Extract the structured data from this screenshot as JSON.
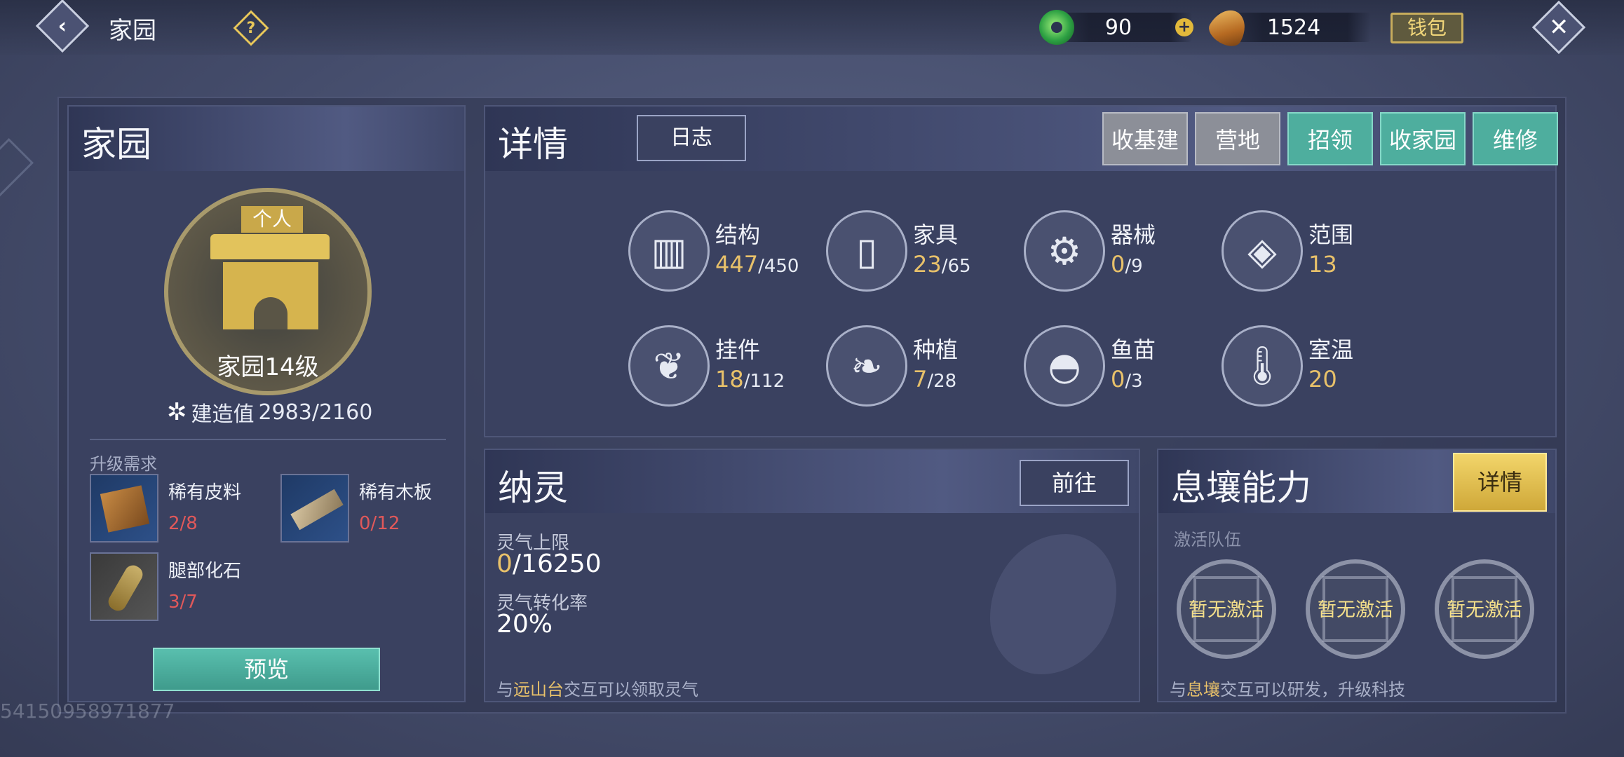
{
  "topbar": {
    "title": "家园",
    "help_icon": "?",
    "jade_amount": "90",
    "coin_amount": "1524",
    "wallet_label": "钱包"
  },
  "left_panel": {
    "title": "家园",
    "emblem_tag": "个人",
    "level_label": "家园14级",
    "build_label": "建造值",
    "build_value": "2983/2160",
    "requirements_title": "升级需求",
    "materials": [
      {
        "name": "稀有皮料",
        "count": "2/8",
        "icon": "leather-icon"
      },
      {
        "name": "稀有木板",
        "count": "0/12",
        "icon": "wood-plank-icon"
      },
      {
        "name": "腿部化石",
        "count": "3/7",
        "icon": "fossil-icon"
      }
    ],
    "preview_label": "预览"
  },
  "detail_panel": {
    "title": "详情",
    "log_label": "日志",
    "actions": [
      "收基建",
      "营地",
      "招领",
      "收家园",
      "维修"
    ],
    "stats": [
      {
        "name": "结构",
        "value": "447",
        "max": "/450",
        "icon": "structure-icon"
      },
      {
        "name": "家具",
        "value": "23",
        "max": "/65",
        "icon": "furniture-icon"
      },
      {
        "name": "器械",
        "value": "0",
        "max": "/9",
        "icon": "machinery-icon"
      },
      {
        "name": "范围",
        "value": "13",
        "max": "",
        "icon": "range-icon"
      },
      {
        "name": "挂件",
        "value": "18",
        "max": "/112",
        "icon": "pendant-icon"
      },
      {
        "name": "种植",
        "value": "7",
        "max": "/28",
        "icon": "planting-icon"
      },
      {
        "name": "鱼苗",
        "value": "0",
        "max": "/3",
        "icon": "fish-fry-icon"
      },
      {
        "name": "室温",
        "value": "20",
        "max": "",
        "icon": "thermometer-icon"
      }
    ]
  },
  "spirit_panel": {
    "title": "纳灵",
    "goto_label": "前往",
    "limit_label": "灵气上限",
    "limit_current": "0",
    "limit_max": "/16250",
    "rate_label": "灵气转化率",
    "rate_value": "20%",
    "footer_prefix": "与",
    "footer_highlight": "远山台",
    "footer_suffix": "交互可以领取灵气"
  },
  "ability_panel": {
    "title": "息壤能力",
    "detail_label": "详情",
    "team_label": "激活队伍",
    "slots": [
      "暂无激活",
      "暂无激活",
      "暂无激活"
    ],
    "footer_prefix": "与",
    "footer_highlight": "息壤",
    "footer_suffix": "交互可以研发，升级科技"
  },
  "uid": "54150958971877",
  "colors": {
    "gold": "#e8c16a",
    "red_count": "#e0585a",
    "teal_button": "#4eae9e",
    "gray_button": "#8c8f98",
    "yellow_button": "#cfa839"
  }
}
